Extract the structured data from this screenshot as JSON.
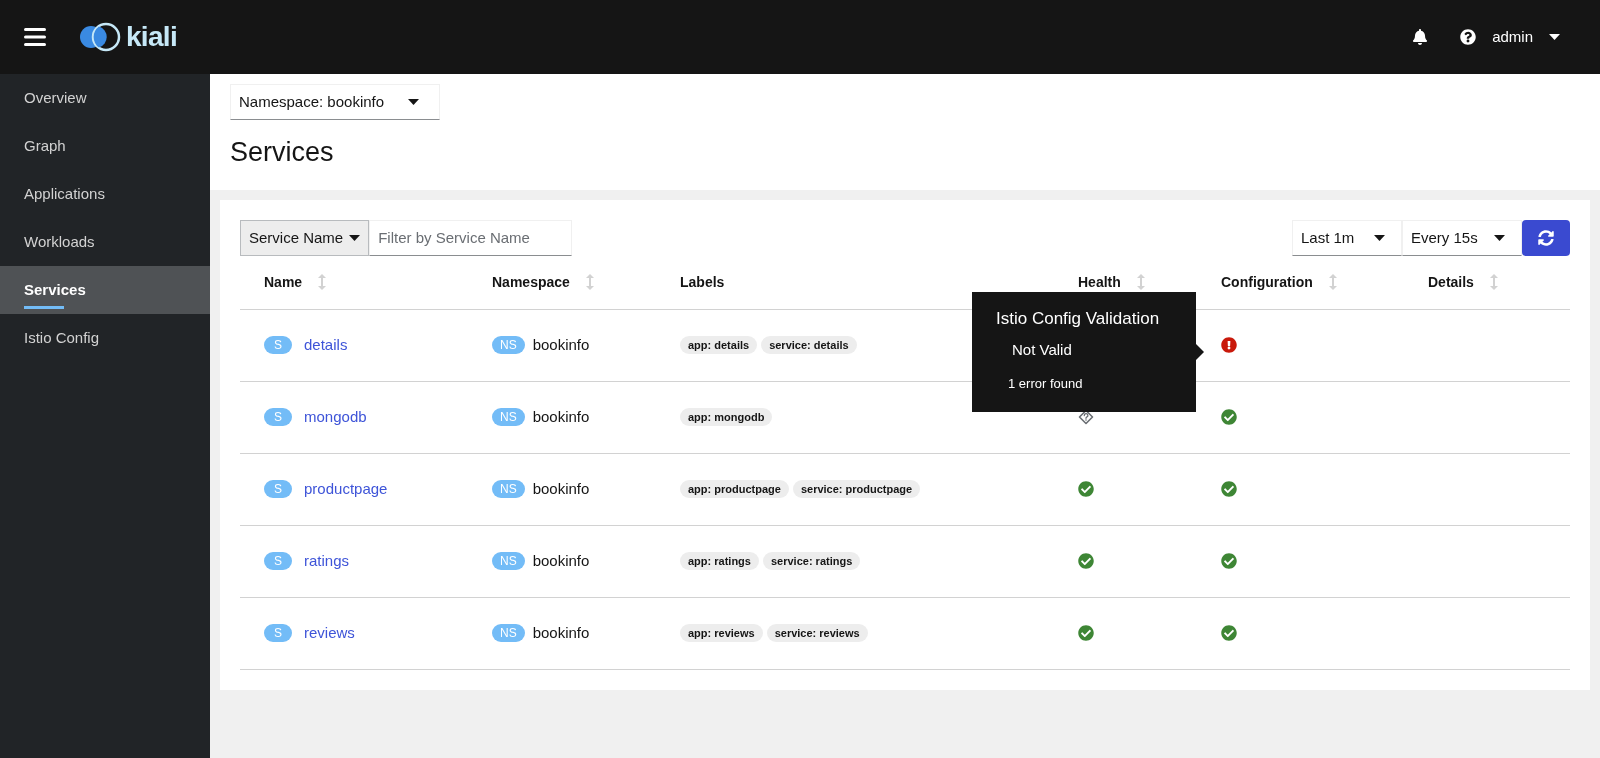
{
  "header": {
    "logo": "kiali",
    "user": "admin"
  },
  "sidebar": {
    "items": [
      {
        "label": "Overview",
        "selected": false
      },
      {
        "label": "Graph",
        "selected": false
      },
      {
        "label": "Applications",
        "selected": false
      },
      {
        "label": "Workloads",
        "selected": false
      },
      {
        "label": "Services",
        "selected": true
      },
      {
        "label": "Istio Config",
        "selected": false
      }
    ]
  },
  "namespace_select": "Namespace: bookinfo",
  "page_title": "Services",
  "toolbar": {
    "filter_type": "Service Name",
    "filter_placeholder": "Filter by Service Name",
    "duration": "Last 1m",
    "refresh_interval": "Every 15s"
  },
  "table": {
    "columns": [
      {
        "label": "Name",
        "sortable": true
      },
      {
        "label": "Namespace",
        "sortable": true
      },
      {
        "label": "Labels",
        "sortable": false
      },
      {
        "label": "Health",
        "sortable": true
      },
      {
        "label": "Configuration",
        "sortable": true
      },
      {
        "label": "Details",
        "sortable": true
      }
    ],
    "rows": [
      {
        "badge": "S",
        "name": "details",
        "ns_badge": "NS",
        "namespace": "bookinfo",
        "labels": [
          "app: details",
          "service: details"
        ],
        "config": {
          "kind": "error"
        }
      },
      {
        "badge": "S",
        "name": "mongodb",
        "ns_badge": "NS",
        "namespace": "bookinfo",
        "labels": [
          "app: mongodb"
        ],
        "health": {
          "kind": "unknown"
        },
        "config": {
          "kind": "ok"
        }
      },
      {
        "badge": "S",
        "name": "productpage",
        "ns_badge": "NS",
        "namespace": "bookinfo",
        "labels": [
          "app: productpage",
          "service: productpage"
        ],
        "health": {
          "kind": "ok"
        },
        "config": {
          "kind": "ok"
        }
      },
      {
        "badge": "S",
        "name": "ratings",
        "ns_badge": "NS",
        "namespace": "bookinfo",
        "labels": [
          "app: ratings",
          "service: ratings"
        ],
        "health": {
          "kind": "ok"
        },
        "config": {
          "kind": "ok"
        }
      },
      {
        "badge": "S",
        "name": "reviews",
        "ns_badge": "NS",
        "namespace": "bookinfo",
        "labels": [
          "app: reviews",
          "service: reviews"
        ],
        "health": {
          "kind": "ok"
        },
        "config": {
          "kind": "ok"
        }
      }
    ]
  },
  "tooltip": {
    "title": "Istio Config Validation",
    "status": "Not Valid",
    "detail": "1 error found"
  }
}
